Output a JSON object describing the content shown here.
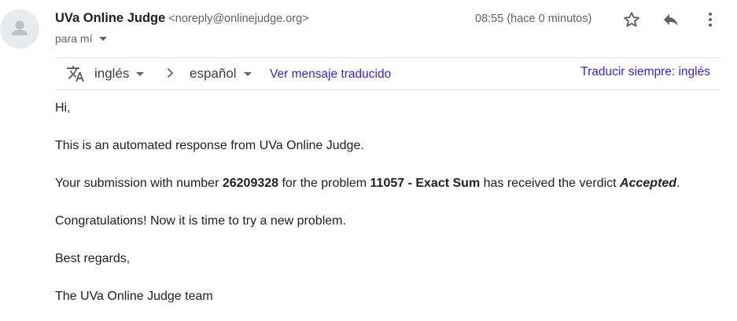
{
  "header": {
    "sender_name": "UVa Online Judge",
    "sender_email": "<noreply@onlinejudge.org>",
    "recipient": "para mí",
    "timestamp": "08:55 (hace 0 minutos)"
  },
  "translate": {
    "from_lang": "inglés",
    "to_lang": "español",
    "view_translated": "Ver mensaje traducido",
    "always_translate": "Traducir siempre: inglés"
  },
  "message": {
    "greeting": "Hi,",
    "intro": "This is an automated response from UVa Online Judge.",
    "submission_prefix": "Your submission with number ",
    "submission_number": "26209328",
    "problem_prefix": " for the problem ",
    "problem_name": "11057 - Exact Sum",
    "verdict_prefix": " has received the verdict ",
    "verdict": "Accepted",
    "verdict_suffix": ".",
    "congrats": "Congratulations! Now it is time to try a new problem.",
    "closing": "Best regards,",
    "signature": "The UVa Online Judge team"
  },
  "icons": {
    "avatar": "person-icon",
    "star": "star-icon",
    "reply": "reply-icon",
    "more": "more-vert-icon",
    "translate": "translate-icon",
    "arrow": "chevron-right-icon"
  },
  "colors": {
    "link": "#3c1ee0",
    "secondary_text": "#5f6368",
    "avatar_bg": "#e8eaed"
  }
}
